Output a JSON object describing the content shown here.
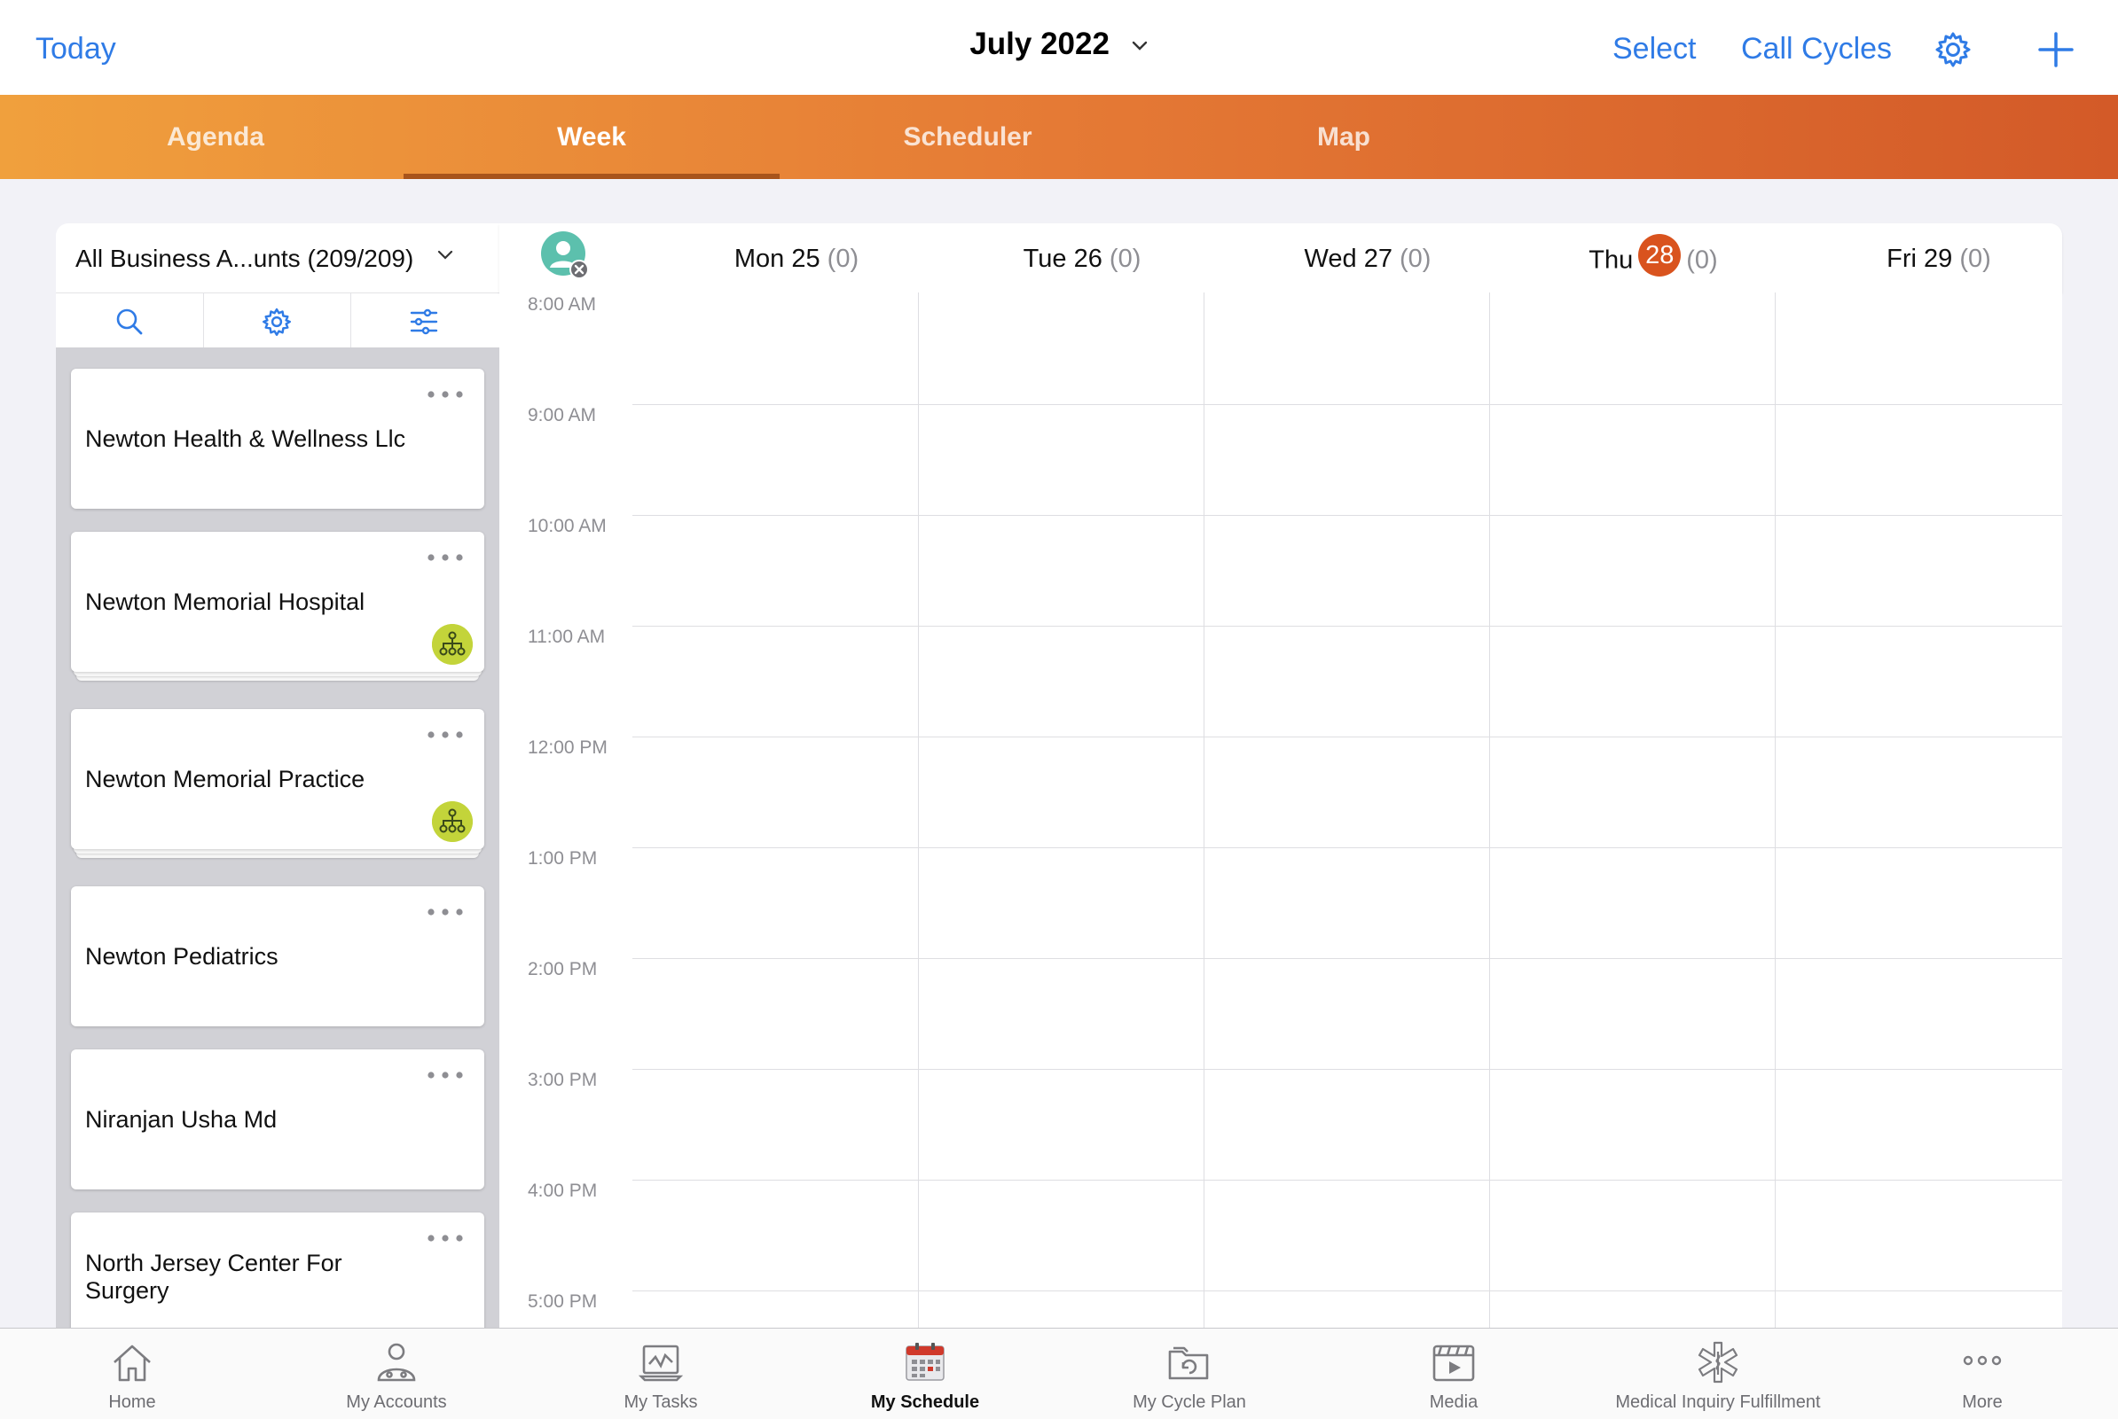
{
  "header": {
    "today_label": "Today",
    "month_label": "July 2022",
    "select_label": "Select",
    "call_cycles_label": "Call Cycles"
  },
  "tabs": [
    {
      "label": "Agenda",
      "active": false
    },
    {
      "label": "Week",
      "active": true
    },
    {
      "label": "Scheduler",
      "active": false
    },
    {
      "label": "Map",
      "active": false
    }
  ],
  "sidebar": {
    "filter_label": "All Business A...unts (209/209)",
    "accounts": [
      {
        "name": "Newton Health & Wellness Llc",
        "org_icon": false
      },
      {
        "name": "Newton Memorial Hospital",
        "org_icon": true
      },
      {
        "name": "Newton Memorial Practice",
        "org_icon": true
      },
      {
        "name": "Newton Pediatrics",
        "org_icon": false
      },
      {
        "name": "Niranjan Usha Md",
        "org_icon": false
      },
      {
        "name": "North Jersey Center For Surgery",
        "org_icon": false
      }
    ]
  },
  "calendar": {
    "days": [
      {
        "label": "Mon 25",
        "count": "(0)",
        "today": false
      },
      {
        "label": "Tue 26",
        "count": "(0)",
        "today": false
      },
      {
        "label": "Wed 27",
        "count": "(0)",
        "today": false
      },
      {
        "label": "Thu",
        "date_badge": "28",
        "count": "(0)",
        "today": true
      },
      {
        "label": "Fri 29",
        "count": "(0)",
        "today": false
      }
    ],
    "times": [
      "8:00 AM",
      "9:00 AM",
      "10:00 AM",
      "11:00 AM",
      "12:00 PM",
      "1:00 PM",
      "2:00 PM",
      "3:00 PM",
      "4:00 PM",
      "5:00 PM"
    ]
  },
  "bottom_tabs": [
    {
      "label": "Home",
      "icon": "home-icon",
      "active": false
    },
    {
      "label": "My Accounts",
      "icon": "accounts-icon",
      "active": false
    },
    {
      "label": "My Tasks",
      "icon": "tasks-icon",
      "active": false
    },
    {
      "label": "My Schedule",
      "icon": "calendar-icon",
      "active": true
    },
    {
      "label": "My Cycle Plan",
      "icon": "cycle-plan-icon",
      "active": false
    },
    {
      "label": "Media",
      "icon": "media-icon",
      "active": false
    },
    {
      "label": "Medical Inquiry Fulfillment",
      "icon": "medical-icon",
      "active": false
    },
    {
      "label": "More",
      "icon": "more-icon",
      "active": false
    }
  ],
  "colors": {
    "accent_blue": "#2f7be6",
    "tab_gradient_start": "#f0a03d",
    "tab_gradient_end": "#d35a28",
    "today_badge": "#d9531e",
    "org_icon": "#c3d43a"
  }
}
